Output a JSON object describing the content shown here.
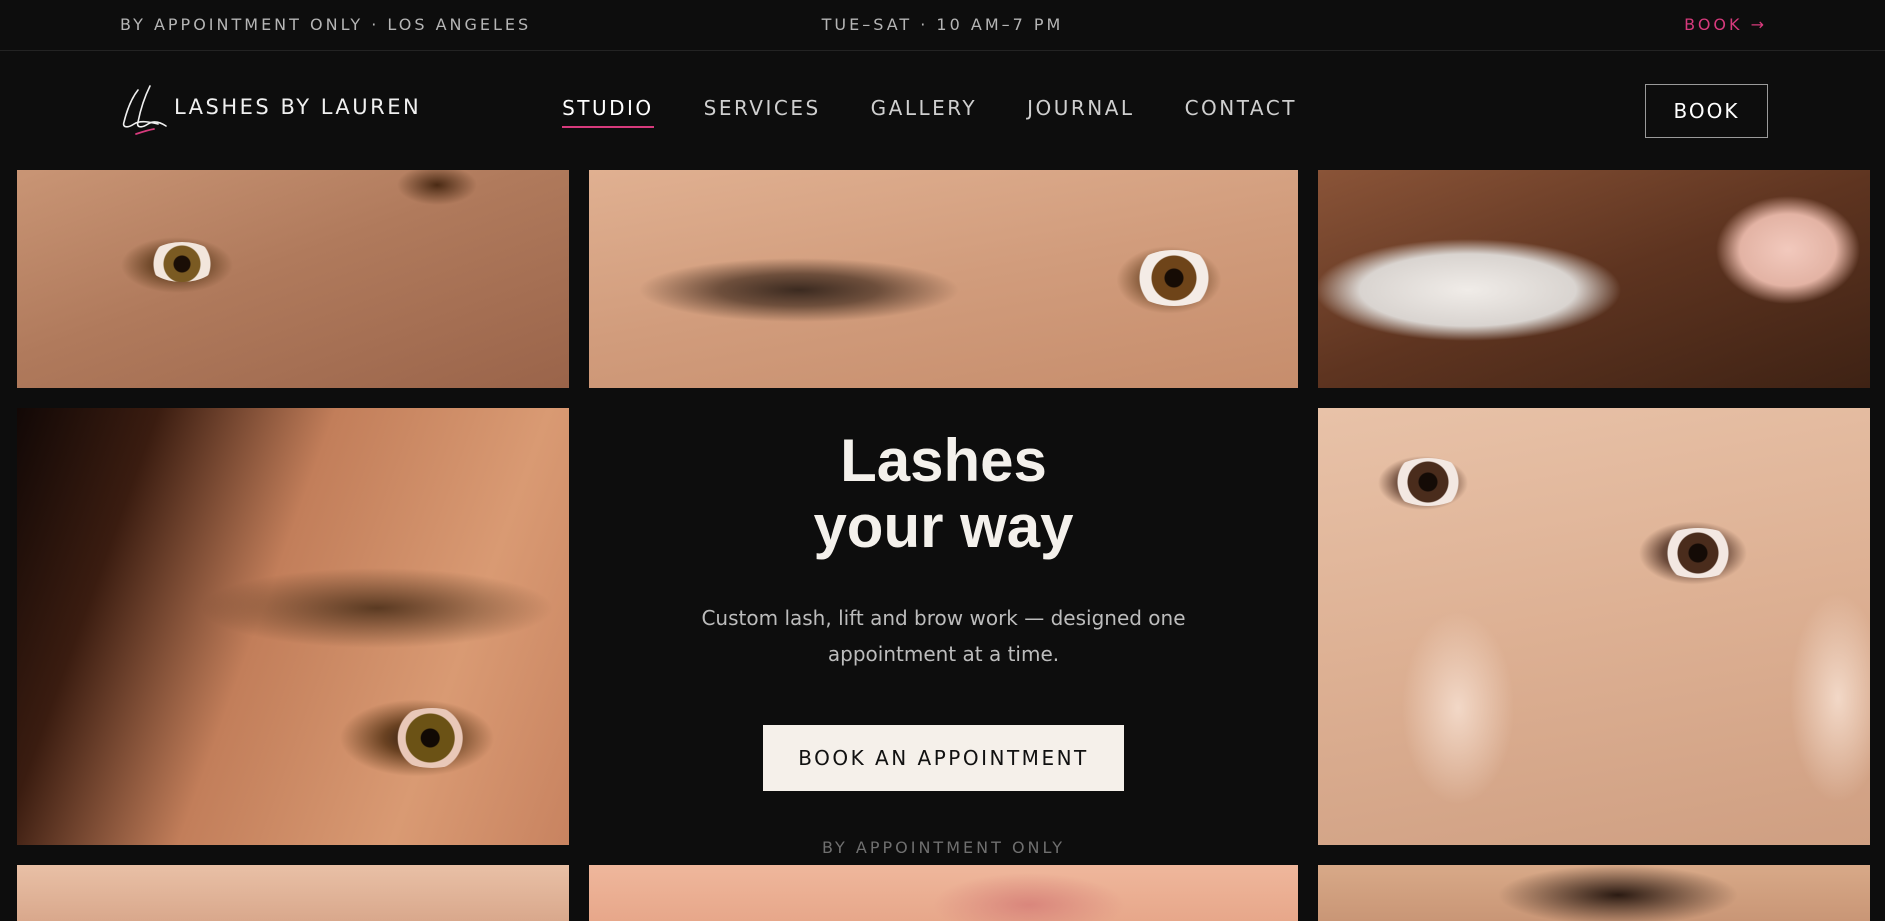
{
  "topbar": {
    "left_text": "BY APPOINTMENT ONLY · LOS ANGELES",
    "hours": "TUE–SAT · 10 AM–7 PM",
    "book_link": "BOOK →"
  },
  "brand": {
    "logo_icon": "script-ll-monogram",
    "name": "LASHES BY LAUREN"
  },
  "nav": {
    "items": [
      {
        "label": "STUDIO",
        "active": true
      },
      {
        "label": "SERVICES",
        "active": false
      },
      {
        "label": "GALLERY",
        "active": false
      },
      {
        "label": "JOURNAL",
        "active": false
      },
      {
        "label": "CONTACT",
        "active": false
      }
    ],
    "book_button": "BOOK"
  },
  "hero": {
    "title_line1": "Lashes",
    "title_line2": "your way",
    "subtitle": "Custom lash, lift and brow work — designed one appointment at a time.",
    "cta": "BOOK AN APPOINTMENT",
    "note": "BY APPOINTMENT ONLY"
  },
  "colors": {
    "background": "#0d0d0d",
    "accent": "#d63a7c",
    "cta_bg": "#f5f0ea"
  }
}
